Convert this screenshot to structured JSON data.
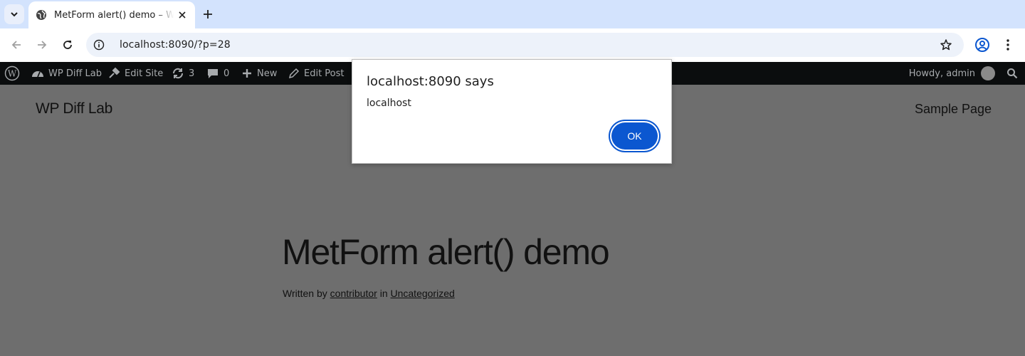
{
  "browser": {
    "tab_title": "MetForm alert() demo – WP Diff Lab",
    "url": "localhost:8090/?p=28"
  },
  "adminbar": {
    "site_name": "WP Diff Lab",
    "edit_site": "Edit Site",
    "updates_count": "3",
    "comments_count": "0",
    "new_label": "New",
    "edit_post": "Edit Post",
    "howdy": "Howdy, admin"
  },
  "site": {
    "title": "WP Diff Lab",
    "nav_item": "Sample Page"
  },
  "post": {
    "title": "MetForm alert() demo",
    "byline_prefix": "Written by",
    "author": "contributor",
    "in_text": "in",
    "category": "Uncategorized"
  },
  "dialog": {
    "heading": "localhost:8090 says",
    "message": "localhost",
    "ok_label": "OK"
  },
  "colors": {
    "tabstrip": "#d3e3fd",
    "omnibox": "#edf2fa",
    "adminbar": "#0b0d0e",
    "overlay_page": "#6e6e6e",
    "ok_button": "#0b57d0"
  }
}
